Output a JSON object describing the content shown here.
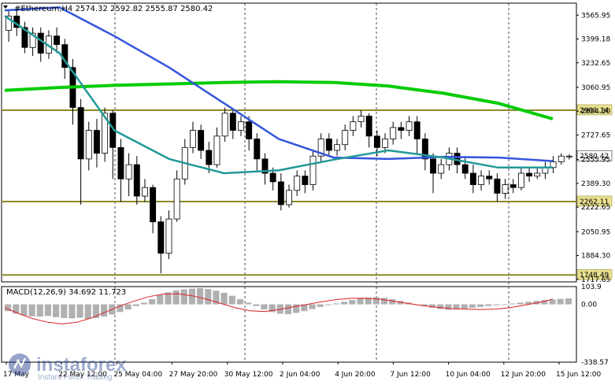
{
  "chart_data": [
    {
      "type": "candlestick",
      "title": "#Ethereum,H4",
      "ohlc": {
        "open": "2574.32",
        "high": "2592.82",
        "low": "2555.87",
        "close": "2580.42"
      },
      "x_tick_labels": [
        "17 May",
        "22 May 12:00",
        "25 May 04:00",
        "27 May 20:00",
        "30 May 12:00",
        "2 Jun 04:00",
        "4 Jun 20:00",
        "7 Jun 12:00",
        "10 Jun 04:00",
        "12 Jun 20:00",
        "15 Jun 12:00"
      ],
      "y_tick_labels": [
        "3565.95",
        "3399.18",
        "3232.65",
        "3060.95",
        "2894.30",
        "2727.65",
        "2555.95",
        "2389.30",
        "2222.65",
        "2050.95",
        "1884.30",
        "1717.65"
      ],
      "ylim": [
        1700,
        3650
      ],
      "current_price_tag": "2580.42",
      "levels": [
        {
          "label": "2901.14",
          "value": 2901.14,
          "color": "#8a8a2a"
        },
        {
          "label": "2262.11",
          "value": 2262.11,
          "color": "#8a8a2a"
        },
        {
          "label": "1748.49",
          "value": 1748.49,
          "color": "#8a8a2a"
        }
      ],
      "moving_averages": [
        {
          "color": "#00cc00",
          "values": [
            3040,
            3060,
            3075,
            3085,
            3095,
            3100,
            3095,
            3070,
            3020,
            2950,
            2840
          ]
        },
        {
          "color": "#3355dd",
          "values": [
            3600,
            3620,
            3420,
            3200,
            2950,
            2700,
            2570,
            2560,
            2575,
            2570,
            2545
          ]
        },
        {
          "color": "#229999",
          "values": [
            3560,
            3300,
            2760,
            2560,
            2460,
            2480,
            2555,
            2620,
            2570,
            2500,
            2500
          ]
        }
      ],
      "candles": [
        [
          3460,
          3560,
          3380,
          3600
        ],
        [
          3560,
          3480,
          3420,
          3620
        ],
        [
          3480,
          3340,
          3300,
          3520
        ],
        [
          3340,
          3440,
          3280,
          3480
        ],
        [
          3440,
          3300,
          3240,
          3480
        ],
        [
          3300,
          3420,
          3260,
          3460
        ],
        [
          3420,
          3360,
          3300,
          3480
        ],
        [
          3360,
          3200,
          3120,
          3400
        ],
        [
          3200,
          2920,
          2800,
          3260
        ],
        [
          2920,
          2560,
          2240,
          2980
        ],
        [
          2560,
          2760,
          2480,
          2820
        ],
        [
          2760,
          2600,
          2500,
          2840
        ],
        [
          2600,
          2880,
          2540,
          2920
        ],
        [
          2880,
          2640,
          2420,
          2900
        ],
        [
          2640,
          2420,
          2260,
          2700
        ],
        [
          2420,
          2520,
          2300,
          2600
        ],
        [
          2520,
          2300,
          2240,
          2580
        ],
        [
          2300,
          2360,
          2260,
          2420
        ],
        [
          2360,
          2120,
          2040,
          2380
        ],
        [
          2120,
          1900,
          1760,
          2160
        ],
        [
          1900,
          2140,
          1860,
          2200
        ],
        [
          2140,
          2420,
          2120,
          2480
        ],
        [
          2420,
          2640,
          2380,
          2700
        ],
        [
          2640,
          2760,
          2600,
          2820
        ],
        [
          2760,
          2620,
          2560,
          2800
        ],
        [
          2620,
          2520,
          2460,
          2680
        ],
        [
          2520,
          2720,
          2500,
          2780
        ],
        [
          2720,
          2880,
          2680,
          2920
        ],
        [
          2880,
          2760,
          2700,
          2900
        ],
        [
          2760,
          2820,
          2720,
          2860
        ],
        [
          2820,
          2700,
          2620,
          2860
        ],
        [
          2700,
          2560,
          2480,
          2740
        ],
        [
          2560,
          2460,
          2380,
          2600
        ],
        [
          2460,
          2400,
          2340,
          2500
        ],
        [
          2400,
          2240,
          2200,
          2460
        ],
        [
          2240,
          2340,
          2220,
          2380
        ],
        [
          2340,
          2440,
          2300,
          2480
        ],
        [
          2440,
          2380,
          2320,
          2480
        ],
        [
          2380,
          2580,
          2340,
          2620
        ],
        [
          2580,
          2700,
          2540,
          2740
        ],
        [
          2700,
          2620,
          2580,
          2740
        ],
        [
          2620,
          2660,
          2580,
          2700
        ],
        [
          2660,
          2760,
          2620,
          2800
        ],
        [
          2760,
          2820,
          2720,
          2860
        ],
        [
          2820,
          2860,
          2780,
          2900
        ],
        [
          2860,
          2720,
          2640,
          2880
        ],
        [
          2720,
          2640,
          2580,
          2760
        ],
        [
          2640,
          2700,
          2600,
          2740
        ],
        [
          2700,
          2780,
          2660,
          2820
        ],
        [
          2780,
          2760,
          2700,
          2820
        ],
        [
          2760,
          2820,
          2720,
          2860
        ],
        [
          2820,
          2700,
          2600,
          2860
        ],
        [
          2700,
          2560,
          2480,
          2740
        ],
        [
          2560,
          2460,
          2320,
          2600
        ],
        [
          2460,
          2520,
          2420,
          2560
        ],
        [
          2520,
          2600,
          2480,
          2640
        ],
        [
          2600,
          2520,
          2460,
          2640
        ],
        [
          2520,
          2460,
          2420,
          2580
        ],
        [
          2460,
          2380,
          2320,
          2520
        ],
        [
          2380,
          2440,
          2340,
          2480
        ],
        [
          2440,
          2420,
          2380,
          2480
        ],
        [
          2420,
          2320,
          2260,
          2460
        ],
        [
          2320,
          2380,
          2280,
          2420
        ],
        [
          2380,
          2360,
          2320,
          2420
        ],
        [
          2360,
          2460,
          2340,
          2500
        ],
        [
          2460,
          2440,
          2400,
          2500
        ],
        [
          2440,
          2460,
          2420,
          2500
        ],
        [
          2460,
          2500,
          2420,
          2540
        ],
        [
          2500,
          2540,
          2460,
          2580
        ],
        [
          2540,
          2580,
          2520,
          2600
        ],
        [
          2574,
          2580,
          2556,
          2593
        ]
      ]
    },
    {
      "type": "histogram",
      "title": "MACD(12,26,9) 34.692 11.723",
      "y_tick_labels": [
        "103.9",
        "0.00",
        "-338.57"
      ],
      "ylim": [
        -338.57,
        103.9
      ],
      "histogram_values": [
        -40,
        -55,
        -65,
        -70,
        -72,
        -68,
        -75,
        -80,
        -82,
        -78,
        -85,
        -80,
        -72,
        -60,
        -45,
        -30,
        -10,
        10,
        30,
        55,
        70,
        82,
        88,
        92,
        95,
        90,
        80,
        68,
        50,
        30,
        10,
        -10,
        -30,
        -45,
        -55,
        -58,
        -50,
        -40,
        -28,
        -15,
        -5,
        5,
        15,
        25,
        35,
        40,
        42,
        38,
        30,
        20,
        10,
        0,
        -10,
        -20,
        -28,
        -32,
        -30,
        -25,
        -20,
        -15,
        -10,
        -5,
        0,
        5,
        10,
        15,
        20,
        25,
        28,
        32,
        35
      ],
      "signal_values": [
        -20,
        -55,
        -85,
        -105,
        -115,
        -105,
        -80,
        -45,
        -10,
        20,
        45,
        60,
        62,
        50,
        30,
        5,
        -20,
        -38,
        -42,
        -30,
        -15,
        0,
        15,
        28,
        35,
        36,
        30,
        18,
        5,
        -8,
        -18,
        -25,
        -28,
        -30,
        -28,
        -20,
        -5,
        10,
        30
      ]
    }
  ],
  "watermark": {
    "brand": "instaforex",
    "tagline": "Instant Forex Trading"
  },
  "close_icon": "close-icon"
}
